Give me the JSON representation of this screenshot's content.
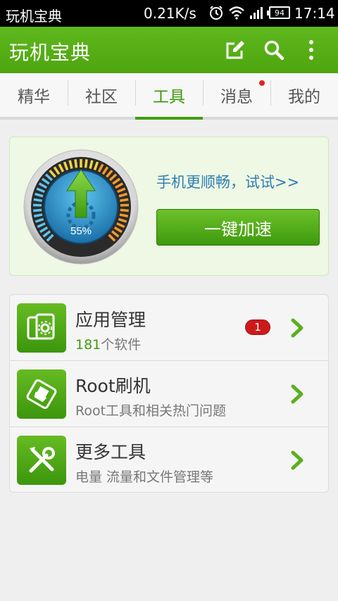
{
  "status_bar": {
    "app_name": "玩机宝典",
    "network_speed": "0.21K/s",
    "battery": "94",
    "time": "17:14"
  },
  "app_bar": {
    "title": "玩机宝典",
    "actions": [
      "edit-icon",
      "search-icon",
      "more-vertical-icon"
    ]
  },
  "tabs": [
    {
      "label": "精华",
      "active": false
    },
    {
      "label": "社区",
      "active": false
    },
    {
      "label": "工具",
      "active": true
    },
    {
      "label": "消息",
      "active": false,
      "unread_dot": true
    },
    {
      "label": "我的",
      "active": false
    }
  ],
  "speed_card": {
    "gauge_percent": "55%",
    "gauge_level": 0.55,
    "tip": "手机更顺畅，试试>>",
    "boost_button": "一键加速"
  },
  "tools": [
    {
      "title": "应用管理",
      "count": "181",
      "subtitle": "个软件",
      "badge": "1",
      "icon": "app-manage-icon"
    },
    {
      "title": "Root刷机",
      "subtitle": "Root工具和相关热门问题",
      "icon": "root-flash-icon"
    },
    {
      "title": "更多工具",
      "subtitle": "电量 流量和文件管理等",
      "icon": "tools-icon"
    }
  ],
  "colors": {
    "primary_green": "#4ea50f",
    "link_blue": "#2f7fb4",
    "badge_red": "#cc1a1a"
  }
}
